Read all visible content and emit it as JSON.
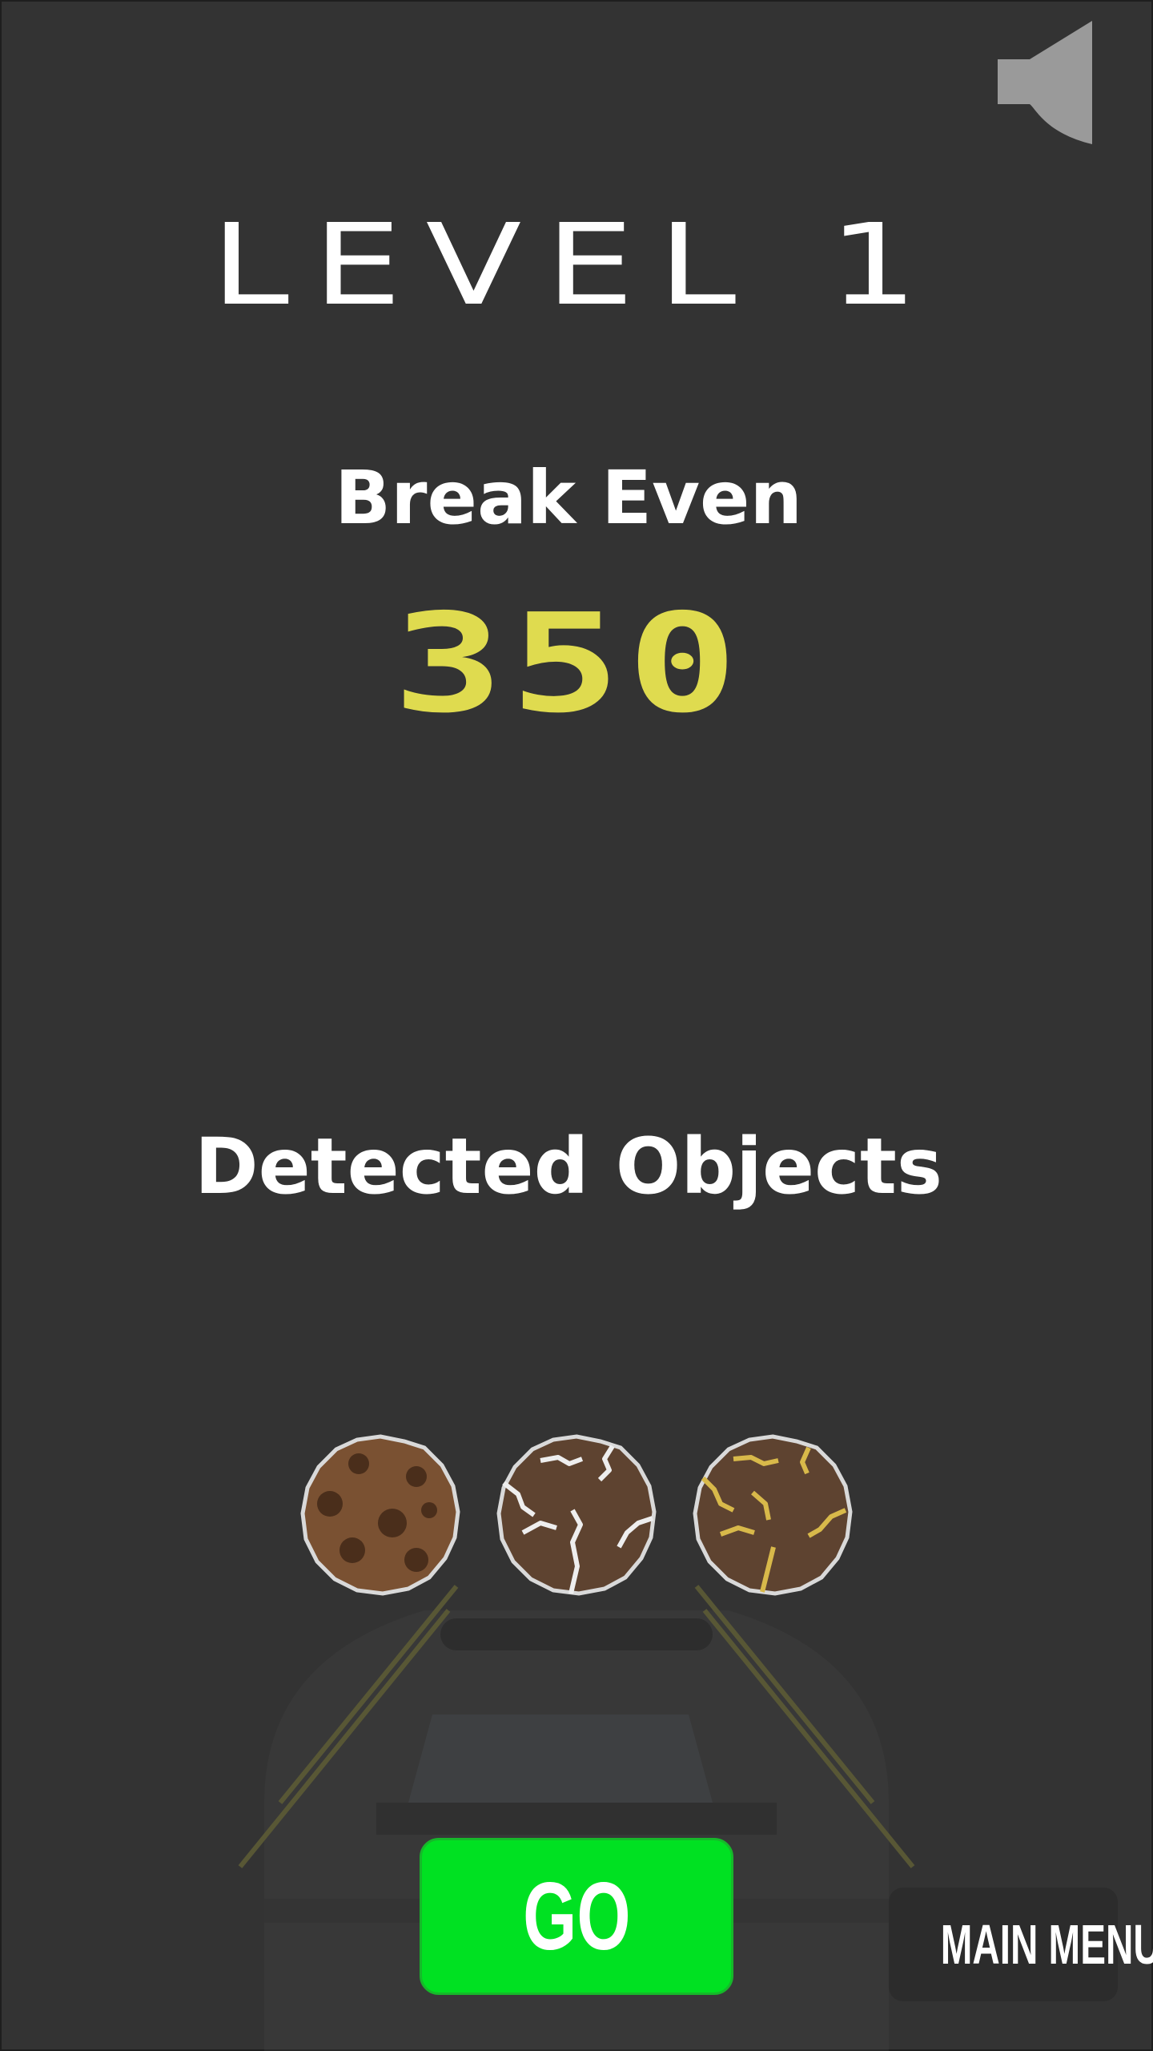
{
  "header": {
    "level_title": "LEVEL 1",
    "sound_icon": "speaker-icon"
  },
  "goal": {
    "label": "Break Even",
    "value": "350",
    "value_color": "#dfdb4f"
  },
  "detected": {
    "label": "Detected Objects",
    "objects": [
      {
        "icon": "chocolate-chip-cookie-icon"
      },
      {
        "icon": "cracked-rock-white-icon",
        "vein_color": "#eeeeee"
      },
      {
        "icon": "cracked-rock-gold-icon",
        "vein_color": "#d8b94a"
      }
    ]
  },
  "buttons": {
    "go_label": "GO",
    "go_color": "#00e122",
    "main_menu_label": "MAIN MENU"
  },
  "background": {
    "color": "#333333",
    "decoration": "robot-silhouette-icon"
  }
}
